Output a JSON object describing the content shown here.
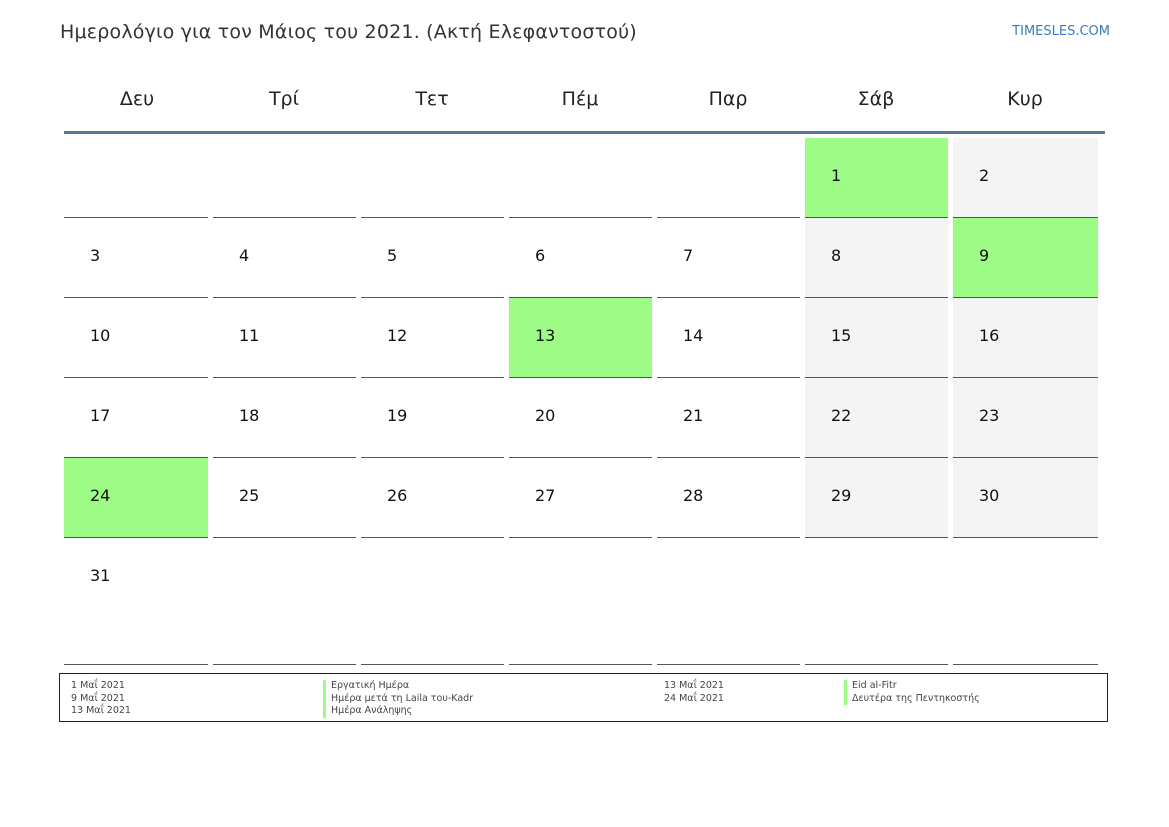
{
  "title": "Ημερολόγιο για τον Μάιος του 2021. (Ακτή Ελεφαντοστού)",
  "brand": "TIMESLES.COM",
  "colors": {
    "holiday": "#9dfc85",
    "weekend": "#f4f4f4",
    "accent": "#5a7799",
    "brand": "#3a7bbf"
  },
  "weekdays": [
    "Δευ",
    "Τρί",
    "Τετ",
    "Πέμ",
    "Παρ",
    "Σάβ",
    "Κυρ"
  ],
  "weeks": [
    [
      {
        "day": "",
        "type": "blank"
      },
      {
        "day": "",
        "type": "blank"
      },
      {
        "day": "",
        "type": "blank"
      },
      {
        "day": "",
        "type": "blank"
      },
      {
        "day": "",
        "type": "blank"
      },
      {
        "day": "1",
        "type": "holiday"
      },
      {
        "day": "2",
        "type": "weekend"
      }
    ],
    [
      {
        "day": "3",
        "type": "normal"
      },
      {
        "day": "4",
        "type": "normal"
      },
      {
        "day": "5",
        "type": "normal"
      },
      {
        "day": "6",
        "type": "normal"
      },
      {
        "day": "7",
        "type": "normal"
      },
      {
        "day": "8",
        "type": "weekend"
      },
      {
        "day": "9",
        "type": "holiday"
      }
    ],
    [
      {
        "day": "10",
        "type": "normal"
      },
      {
        "day": "11",
        "type": "normal"
      },
      {
        "day": "12",
        "type": "normal"
      },
      {
        "day": "13",
        "type": "holiday"
      },
      {
        "day": "14",
        "type": "normal"
      },
      {
        "day": "15",
        "type": "weekend"
      },
      {
        "day": "16",
        "type": "weekend"
      }
    ],
    [
      {
        "day": "17",
        "type": "normal"
      },
      {
        "day": "18",
        "type": "normal"
      },
      {
        "day": "19",
        "type": "normal"
      },
      {
        "day": "20",
        "type": "normal"
      },
      {
        "day": "21",
        "type": "normal"
      },
      {
        "day": "22",
        "type": "weekend"
      },
      {
        "day": "23",
        "type": "weekend"
      }
    ],
    [
      {
        "day": "24",
        "type": "holiday"
      },
      {
        "day": "25",
        "type": "normal"
      },
      {
        "day": "26",
        "type": "normal"
      },
      {
        "day": "27",
        "type": "normal"
      },
      {
        "day": "28",
        "type": "normal"
      },
      {
        "day": "29",
        "type": "weekend"
      },
      {
        "day": "30",
        "type": "weekend"
      }
    ],
    [
      {
        "day": "31",
        "type": "normal"
      },
      {
        "day": "",
        "type": "blank"
      },
      {
        "day": "",
        "type": "blank"
      },
      {
        "day": "",
        "type": "blank"
      },
      {
        "day": "",
        "type": "blank"
      },
      {
        "day": "",
        "type": "blank"
      },
      {
        "day": "",
        "type": "blank"
      }
    ]
  ],
  "legend": {
    "left": [
      {
        "date": "1 Μαΐ 2021",
        "name": "Εργατική Ημέρα"
      },
      {
        "date": "9 Μαΐ 2021",
        "name": "Ημέρα μετά τη Laila του-Kadr"
      },
      {
        "date": "13 Μαΐ 2021",
        "name": "Ημέρα Ανάληψης"
      }
    ],
    "right": [
      {
        "date": "13 Μαΐ 2021",
        "name": "Eid al-Fitr"
      },
      {
        "date": "24 Μαΐ 2021",
        "name": "Δευτέρα της Πεντηκοστής"
      }
    ]
  }
}
